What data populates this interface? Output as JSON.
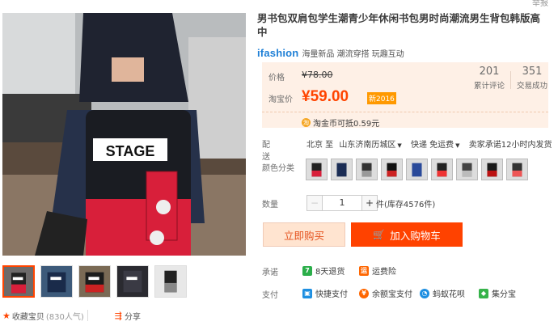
{
  "top_link": "举报",
  "product": {
    "title": "男书包双肩包学生潮青少年休闲书包男时尚潮流男生背包韩版高中",
    "brand_logo": "ifashion",
    "brand_tagline": "海量新品 潮流穿搭 玩趣互动"
  },
  "price": {
    "original_label": "价格",
    "original_value": "¥78.00",
    "promo_label": "淘宝价",
    "promo_value": "¥59.00",
    "promo_badge": "新2016"
  },
  "stats": [
    {
      "count": "201",
      "label": "累计评论"
    },
    {
      "count": "351",
      "label": "交易成功"
    }
  ],
  "coin_offer": "淘金币可抵0.59元",
  "shipping": {
    "label": "配送",
    "from": "北京 至",
    "destination": "山东济南历城区",
    "method": "快递 免运费",
    "promise": "卖家承诺12小时内发货"
  },
  "colors": {
    "label": "颜色分类",
    "swatches": [
      "swatch-1",
      "swatch-2",
      "swatch-3",
      "swatch-4",
      "swatch-5",
      "swatch-6",
      "swatch-7",
      "swatch-8",
      "swatch-9"
    ]
  },
  "quantity": {
    "label": "数量",
    "value": "1",
    "minus": "−",
    "plus": "+",
    "stock": "件(库存4576件)"
  },
  "buttons": {
    "buy_now": "立即购买",
    "add_to_cart": "加入购物车"
  },
  "promise": {
    "label": "承诺",
    "return_icon_text": "7",
    "return_text": "8天退货",
    "freight_icon_text": "运",
    "freight_text": "运费险"
  },
  "payment": {
    "label": "支付",
    "methods": [
      "快捷支付",
      "余额宝支付",
      "蚂蚁花呗",
      "集分宝"
    ]
  },
  "gallery_actions": {
    "favorite": "收藏宝贝",
    "popularity": "(830人气)",
    "share": "分享"
  },
  "image_text": "STAGE",
  "colors_theme": {
    "accent": "#ff4400",
    "price": "#ff4400",
    "brand": "#1e7fd6"
  }
}
